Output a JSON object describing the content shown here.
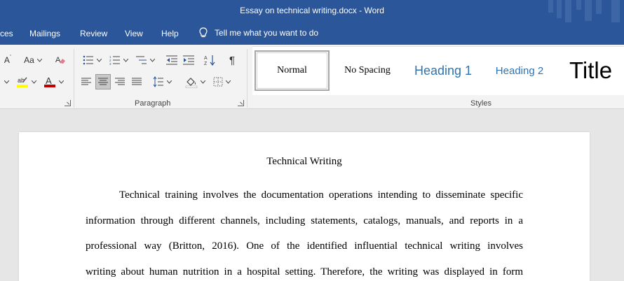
{
  "window": {
    "title": "Essay on technical writing.docx  -  Word"
  },
  "tabs": [
    {
      "label": "ces"
    },
    {
      "label": "Mailings"
    },
    {
      "label": "Review"
    },
    {
      "label": "View"
    },
    {
      "label": "Help"
    }
  ],
  "tell_me": {
    "label": "Tell me what you want to do"
  },
  "ribbon": {
    "font": {
      "grow_label": "A",
      "case_label": "Aa"
    },
    "paragraph": {
      "label": "Paragraph"
    },
    "styles": {
      "label": "Styles",
      "items": [
        "Normal",
        "No Spacing",
        "Heading 1",
        "Heading 2",
        "Title"
      ]
    }
  },
  "colors": {
    "brand": "#2b579a",
    "highlight": "#ffff00",
    "font_color": "#c00000",
    "heading": "#2e74b5"
  },
  "document": {
    "title": "Technical Writing",
    "lines": [
      "Technical training involves the documentation operations intending to disseminate specific",
      "information through different channels, including statements, catalogs, manuals, and reports in a",
      "professional way (Britton, 2016). One of the identified influential technical writing involves",
      "writing about human nutrition in a hospital setting. Therefore, the writing was displayed in form"
    ]
  }
}
